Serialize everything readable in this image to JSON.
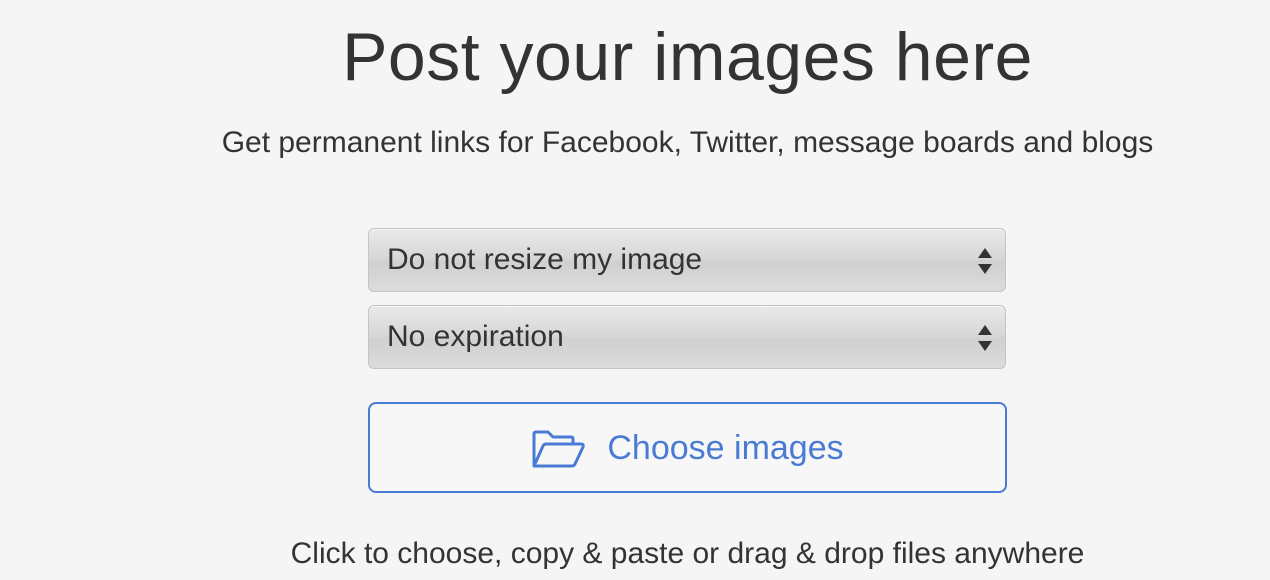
{
  "header": {
    "title": "Post your images here",
    "subtitle": "Get permanent links for Facebook, Twitter, message boards and blogs"
  },
  "options": {
    "resize": {
      "selected": "Do not resize my image"
    },
    "expiration": {
      "selected": "No expiration"
    }
  },
  "upload": {
    "button_label": "Choose images",
    "icon": "folder-open-icon",
    "accent_color": "#4a7bd4",
    "hint": "Click to choose, copy & paste or drag & drop files anywhere"
  }
}
